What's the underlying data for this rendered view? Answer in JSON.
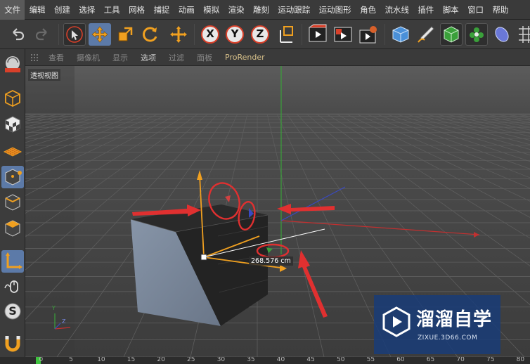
{
  "menubar": {
    "items": [
      "文件",
      "编辑",
      "创建",
      "选择",
      "工具",
      "网格",
      "捕捉",
      "动画",
      "模拟",
      "渲染",
      "雕刻",
      "运动跟踪",
      "运动图形",
      "角色",
      "流水线",
      "插件",
      "脚本",
      "窗口",
      "帮助"
    ]
  },
  "toolbar": {
    "tools": [
      "undo-icon",
      "redo-icon",
      "select-icon",
      "move-icon",
      "scale-icon",
      "rotate-icon",
      "last-tool-icon",
      "x-axis-icon",
      "y-axis-icon",
      "z-axis-icon",
      "coordinate-system-icon",
      "render-view-icon",
      "render-picture-viewer-icon",
      "render-settings-icon",
      "cube-icon",
      "pen-icon",
      "subdivision-icon",
      "array-icon",
      "deformer-icon",
      "floor-icon"
    ],
    "axis_labels": {
      "x": "X",
      "y": "Y",
      "z": "Z"
    }
  },
  "left_toolbar": {
    "tools": [
      "object-mode-icon",
      "model-mode-icon",
      "texture-mode-icon",
      "workplane-icon",
      "point-mode-icon",
      "edge-mode-icon",
      "polygon-mode-icon",
      "axis-mode-icon",
      "tweak-icon",
      "snap-icon",
      "magnet-icon"
    ],
    "snap_label": "S"
  },
  "viewport_menu": {
    "items": [
      "查看",
      "摄像机",
      "显示",
      "选项",
      "过滤",
      "面板"
    ],
    "renderer": "ProRender",
    "active": "选项"
  },
  "viewport": {
    "label": "透视视图",
    "measure": "268.576 cm",
    "axis_mini": {
      "y": "Y",
      "z": "Z"
    }
  },
  "watermark": {
    "title": "溜溜自学",
    "url": "ZIXUE.3D66.COM"
  },
  "timeline": {
    "ticks": [
      "0",
      "5",
      "10",
      "15",
      "20",
      "25",
      "30",
      "35",
      "40",
      "45",
      "50",
      "55",
      "60",
      "65",
      "70",
      "75",
      "80"
    ],
    "current_frame": 0
  },
  "colors": {
    "highlight": "#5c7aa8",
    "annotation_red": "#e03030",
    "axis_x": "#c23030",
    "axis_y": "#3aa03a",
    "axis_z": "#3a4ac2",
    "gizmo_orange": "#f0a020"
  }
}
